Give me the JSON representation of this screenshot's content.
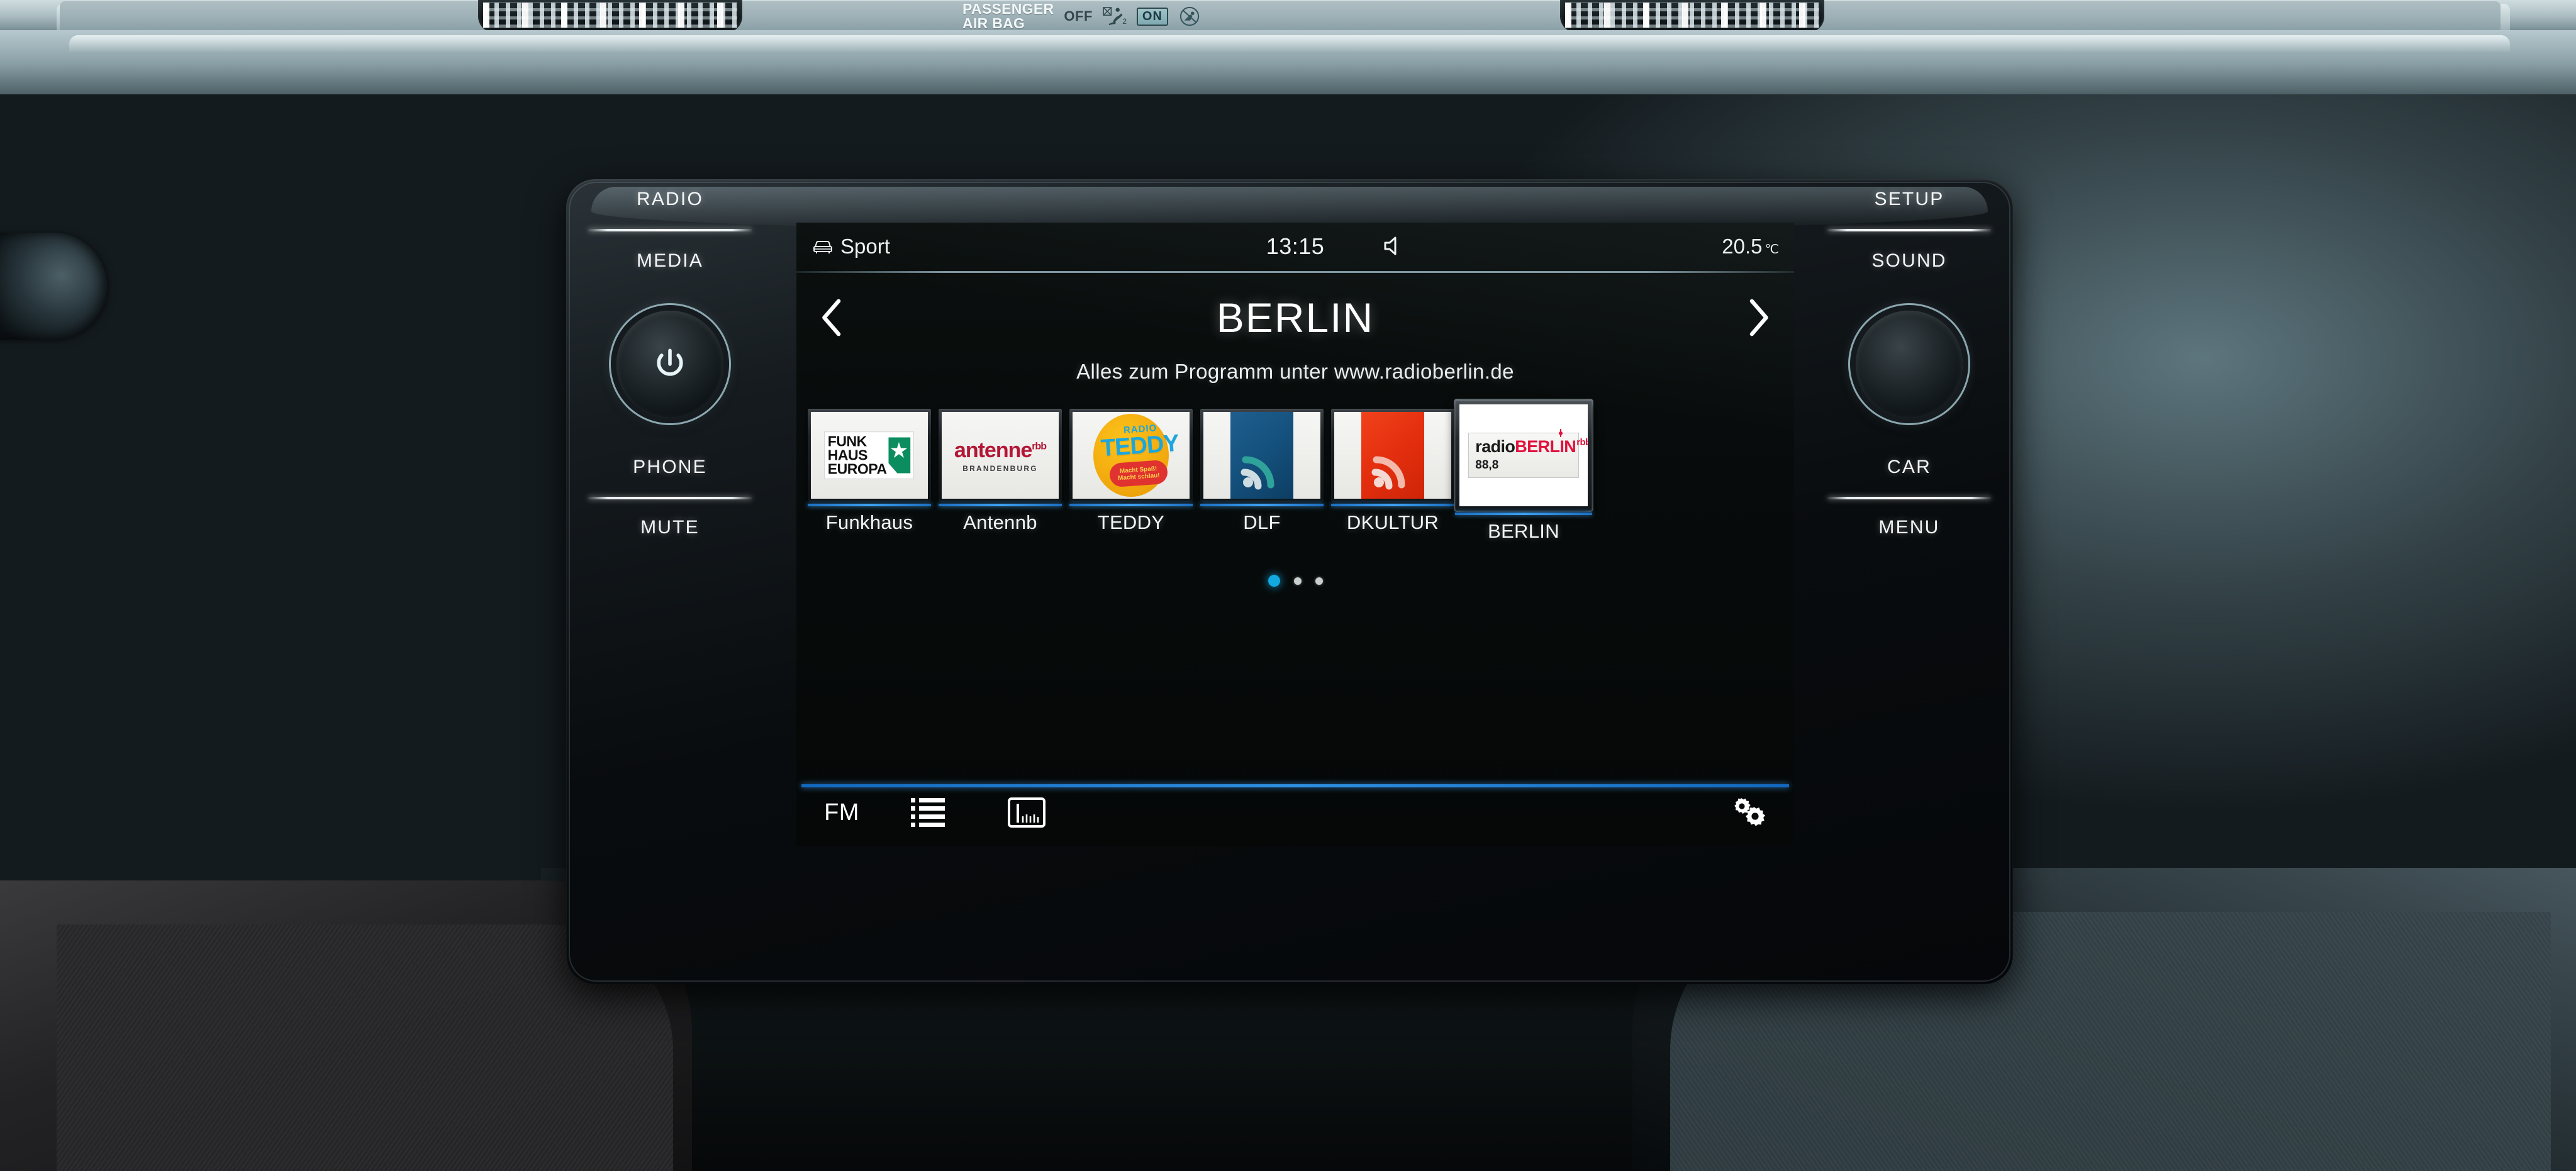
{
  "dashboard": {
    "airbag": {
      "title_line1": "PASSENGER",
      "title_line2": "AIR BAG",
      "off_label": "OFF",
      "on_label": "ON",
      "off_icon": "airbag-off-icon",
      "on_icon": "child-seat-prohibited-icon"
    },
    "hardware_left": [
      {
        "label": "RADIO",
        "name": "radio-button"
      },
      {
        "label": "MEDIA",
        "name": "media-button"
      },
      {
        "label": "PHONE",
        "name": "phone-button"
      },
      {
        "label": "MUTE",
        "name": "mute-button"
      }
    ],
    "hardware_right": [
      {
        "label": "SETUP",
        "name": "setup-button"
      },
      {
        "label": "SOUND",
        "name": "sound-button"
      },
      {
        "label": "CAR",
        "name": "car-button"
      },
      {
        "label": "MENU",
        "name": "menu-button"
      }
    ],
    "power_knob": {
      "icon": "power-icon"
    },
    "tune_knob": {
      "icon": "rotary-knob"
    }
  },
  "screen": {
    "statusbar": {
      "profile_icon": "car-front-icon",
      "profile_label": "Sport",
      "time": "13:15",
      "mute_icon": "speaker-mute-icon",
      "temperature": "20.5",
      "temperature_unit": "℃"
    },
    "header": {
      "prev_icon": "chevron-left-icon",
      "station_name": "BERLIN",
      "next_icon": "chevron-right-icon",
      "radio_text": "Alles zum Programm unter www.radioberlin.de"
    },
    "presets": [
      {
        "label": "Funkhaus",
        "selected": false,
        "logo": "funkhaus-europa-logo",
        "logo_text": {
          "line1": "FUNK",
          "line2": "HAUS",
          "line3": "EUROPA"
        }
      },
      {
        "label": "Antennb",
        "selected": false,
        "logo": "antenne-brandenburg-logo",
        "logo_text": {
          "main": "antenne",
          "sup": "rbb",
          "sub": "BRANDENBURG"
        }
      },
      {
        "label": "TEDDY",
        "selected": false,
        "logo": "radio-teddy-logo",
        "logo_text": {
          "radio": "RADIO",
          "name": "TEDDY",
          "slogan1": "Macht Spaß!",
          "slogan2": "Macht schlau!"
        }
      },
      {
        "label": "DLF",
        "selected": false,
        "logo": "deutschlandfunk-logo"
      },
      {
        "label": "DKULTUR",
        "selected": false,
        "logo": "deutschlandfunk-kultur-logo"
      },
      {
        "label": "BERLIN",
        "selected": true,
        "logo": "radio-berlin-rbb-logo",
        "logo_text": {
          "pre": "radio",
          "main": "BERLIN",
          "sup": "rbb",
          "freq": "88,8"
        }
      }
    ],
    "pagination": {
      "total": 3,
      "active_index": 0
    },
    "bottombar": {
      "band_label": "FM",
      "list_icon": "station-list-icon",
      "tuner_icon": "manual-tuner-icon",
      "settings_icon": "settings-gears-icon"
    }
  },
  "colors": {
    "accent_blue": "#2f90e2",
    "active_dot": "#12a8e0",
    "antenne_red": "#b31635",
    "teddy_yellow": "#f0a60c",
    "teddy_blue": "#1ba6dd",
    "teddy_red": "#e0322f",
    "dlf_blue": "#15527f",
    "dkultur_red": "#e5300f",
    "berlin_red": "#e1123c",
    "funkhaus_green": "#0c8d5f"
  }
}
